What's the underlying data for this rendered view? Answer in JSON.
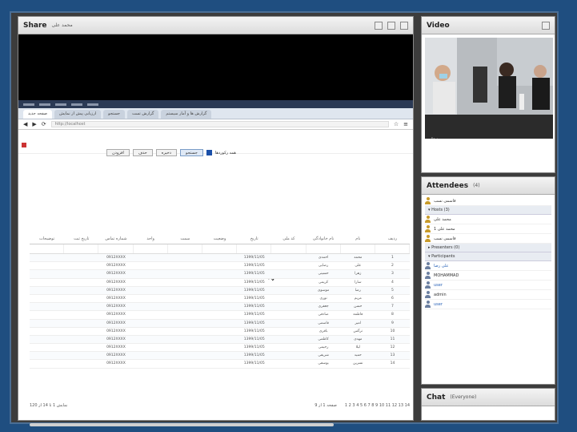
{
  "share": {
    "title": "Share",
    "subtitle": "محمد علی"
  },
  "browser": {
    "tabs": [
      "صفحه جدید",
      "ارزیابی پیش از نمایش",
      "جستجو",
      "گزارش تست",
      "گزارش ها و آمار سیستم"
    ],
    "address": "http://localhost"
  },
  "toolbar": {
    "buttons": [
      "جستجو",
      "لیست",
      "ذخیره",
      "حذف",
      "افزودن"
    ],
    "checkbox_label": "همه رکوردها"
  },
  "table": {
    "headers": [
      "ردیف",
      "نام",
      "نام خانوادگی",
      "کد ملی",
      "تاریخ",
      "وضعیت",
      "سمت",
      "واحد",
      "شماره تماس",
      "تاریخ ثبت",
      "توضیحات"
    ],
    "rows": [
      [
        "1",
        "محمد",
        "احمدی",
        "",
        "1399/11/05",
        "",
        "",
        "",
        "0912XXXX",
        "",
        ""
      ],
      [
        "2",
        "علی",
        "رضایی",
        "",
        "1399/11/05",
        "",
        "",
        "",
        "0912XXXX",
        "",
        ""
      ],
      [
        "3",
        "زهرا",
        "حسینی",
        "",
        "1399/11/05",
        "",
        "",
        "",
        "0912XXXX",
        "",
        ""
      ],
      [
        "4",
        "سارا",
        "کریمی",
        "",
        "1399/11/05",
        "",
        "",
        "",
        "0912XXXX",
        "",
        ""
      ],
      [
        "5",
        "رضا",
        "موسوی",
        "",
        "1399/11/05",
        "",
        "",
        "",
        "0912XXXX",
        "",
        ""
      ],
      [
        "6",
        "مریم",
        "نوری",
        "",
        "1399/11/05",
        "",
        "",
        "",
        "0912XXXX",
        "",
        ""
      ],
      [
        "7",
        "حسن",
        "جعفری",
        "",
        "1399/11/05",
        "",
        "",
        "",
        "0912XXXX",
        "",
        ""
      ],
      [
        "8",
        "فاطمه",
        "صادقی",
        "",
        "1399/11/05",
        "",
        "",
        "",
        "0912XXXX",
        "",
        ""
      ],
      [
        "9",
        "امیر",
        "قاسمی",
        "",
        "1399/11/05",
        "",
        "",
        "",
        "0912XXXX",
        "",
        ""
      ],
      [
        "10",
        "نرگس",
        "باقری",
        "",
        "1399/11/05",
        "",
        "",
        "",
        "0912XXXX",
        "",
        ""
      ],
      [
        "11",
        "مهدی",
        "کاظمی",
        "",
        "1399/11/05",
        "",
        "",
        "",
        "0912XXXX",
        "",
        ""
      ],
      [
        "12",
        "لیلا",
        "رحیمی",
        "",
        "1399/11/05",
        "",
        "",
        "",
        "0912XXXX",
        "",
        ""
      ],
      [
        "13",
        "حمید",
        "شریفی",
        "",
        "1399/11/05",
        "",
        "",
        "",
        "0912XXXX",
        "",
        ""
      ],
      [
        "14",
        "نسرین",
        "یوسفی",
        "",
        "1399/11/05",
        "",
        "",
        "",
        "0912XXXX",
        "",
        ""
      ]
    ]
  },
  "pager": {
    "left": "نمایش 1 تا 14 از 120",
    "middle": "صفحه 1 از 9",
    "right": "1 2 3 4 5 6 7 8 9 10 11 12 13 14"
  },
  "video": {
    "title": "Video",
    "speaker": "محمد علی"
  },
  "attendees": {
    "title": "Attendees",
    "count": "(4)",
    "me": "قاسمی نسب",
    "hosts_label": "▾ Hosts (3)",
    "hosts": [
      "محمد علی",
      "محمد علی 1",
      "قاسمی نسب"
    ],
    "presenters_label": "▸ Presenters (0)",
    "participants_label": "▾ Participants",
    "participants": [
      "علی رضا",
      "MOHAMMAD",
      "user",
      "admin",
      "user"
    ]
  },
  "chat": {
    "title": "Chat",
    "subtitle": "(Everyone)"
  },
  "colors": {
    "background": "#1f4e80",
    "host": "#c89b2a",
    "link": "#2a63b8"
  }
}
